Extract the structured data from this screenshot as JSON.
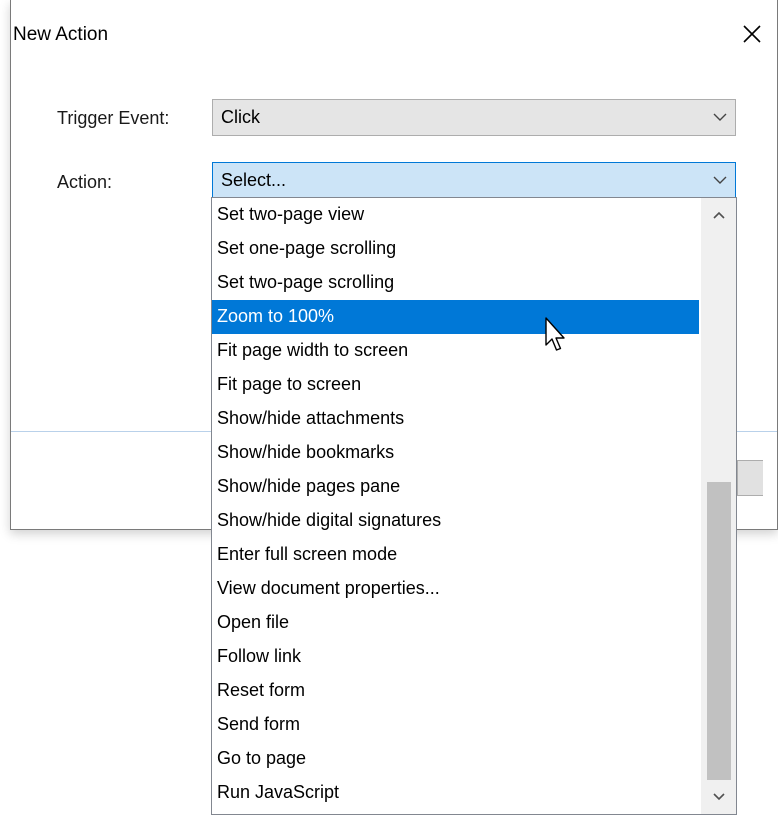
{
  "dialog": {
    "title": "New Action",
    "close_icon": "close-icon"
  },
  "form": {
    "trigger_label": "Trigger Event:",
    "trigger_value": "Click",
    "action_label": "Action:",
    "action_value": "Select..."
  },
  "dropdown": {
    "items": [
      "Set two-page view",
      "Set one-page scrolling",
      "Set two-page scrolling",
      "Zoom to 100%",
      "Fit page width to screen",
      "Fit page to screen",
      "Show/hide attachments",
      "Show/hide bookmarks",
      "Show/hide pages pane",
      "Show/hide digital signatures",
      "Enter full screen mode",
      "View document properties...",
      "Open file",
      "Follow link",
      "Reset form",
      "Send form",
      "Go to page",
      "Run JavaScript"
    ],
    "selected_item": "Zoom to 100%"
  },
  "colors": {
    "selection": "#0078d7",
    "focus_fill": "#cce4f7",
    "scroll_thumb": "#c1c1c1"
  }
}
